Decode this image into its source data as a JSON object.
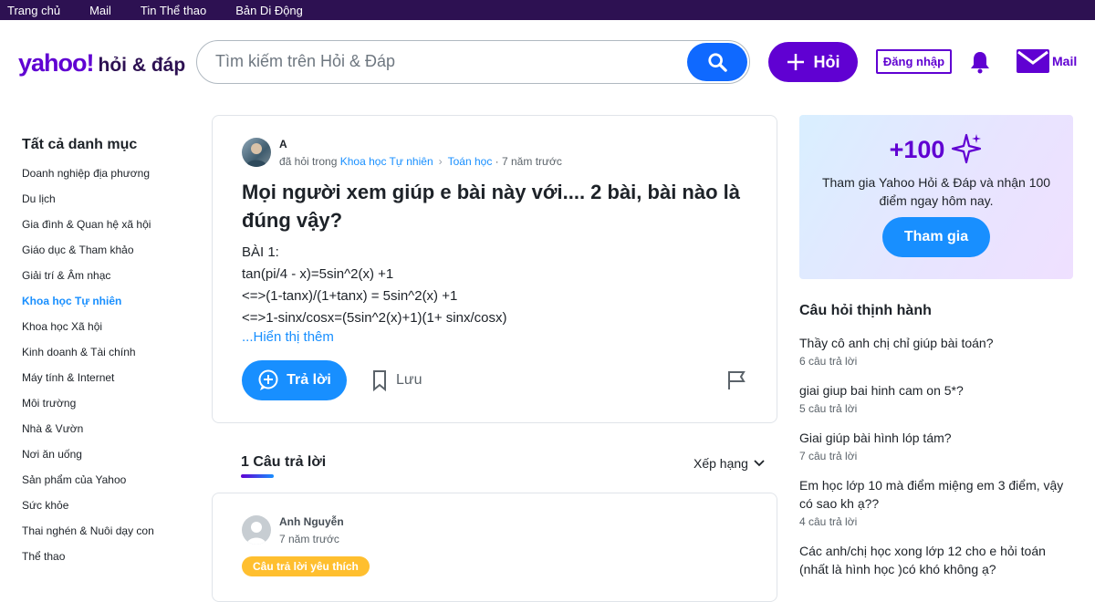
{
  "topnav": [
    "Trang chủ",
    "Mail",
    "Tin Thể thao",
    "Bản Di Động"
  ],
  "header": {
    "logo_brand": "yahoo!",
    "logo_product": "hỏi & đáp",
    "search_placeholder": "Tìm kiếm trên Hỏi & Đáp",
    "ask_label": "Hỏi",
    "login_label": "Đăng nhập",
    "mail_label": "Mail"
  },
  "sidebar": {
    "title": "Tất cả danh mục",
    "categories": [
      "Doanh nghiệp địa phương",
      "Du lịch",
      "Gia đình & Quan hệ xã hội",
      "Giáo dục & Tham khảo",
      "Giải trí & Âm nhạc",
      "Khoa học Tự nhiên",
      "Khoa học Xã hội",
      "Kinh doanh & Tài chính",
      "Máy tính & Internet",
      "Môi trường",
      "Nhà & Vườn",
      "Nơi ăn uống",
      "Sản phẩm của Yahoo",
      "Sức khỏe",
      "Thai nghén & Nuôi dạy con",
      "Thể thao"
    ],
    "active_index": 5
  },
  "question": {
    "author": "A",
    "meta_prefix": "đã hỏi trong",
    "category": "Khoa học Tự nhiên",
    "subcategory": "Toán học",
    "time": "· 7 năm trước",
    "title": "Mọi người xem giúp e bài này với.... 2 bài, bài nào là đúng vậy?",
    "body": [
      "BÀI 1:",
      "tan(pi/4 - x)=5sin^2(x) +1",
      "<=>(1-tanx)/(1+tanx) = 5sin^2(x) +1",
      "<=>1-sinx/cosx=(5sin^2(x)+1)(1+ sinx/cosx)"
    ],
    "show_more": "...Hiển thị thêm",
    "answer_label": "Trả lời",
    "save_label": "Lưu"
  },
  "answers": {
    "count_label": "1 Câu trả lời",
    "sort_label": "Xếp hạng",
    "items": [
      {
        "author": "Anh Nguyễn",
        "time": "7 năm trước",
        "badge": "Câu trả lời yêu thích"
      }
    ]
  },
  "promo": {
    "points": "+100",
    "description": "Tham gia Yahoo Hỏi & Đáp và nhận 100 điểm ngay hôm nay.",
    "join_label": "Tham gia"
  },
  "trending": {
    "title": "Câu hỏi thịnh hành",
    "items": [
      {
        "q": "Thầy cô anh chị chỉ giúp bài toán?",
        "count": "6 câu trả lời"
      },
      {
        "q": "giai giup bai hinh cam on 5*?",
        "count": "5 câu trả lời"
      },
      {
        "q": "Giai giúp bài hình lóp tám?",
        "count": "7 câu trả lời"
      },
      {
        "q": "Em học lớp 10 mà điểm miệng em 3 điểm, vậy có sao kh ạ??",
        "count": "4 câu trả lời"
      },
      {
        "q": "Các anh/chị học xong lớp 12 cho e hỏi toán (nhất là hình học )có khó không ạ?",
        "count": ""
      }
    ]
  },
  "colors": {
    "brand_purple": "#6001d2",
    "topbar": "#2d1152",
    "accent_blue": "#188fff",
    "search_blue": "#0f69ff",
    "badge_yellow": "#ffbf2f"
  }
}
